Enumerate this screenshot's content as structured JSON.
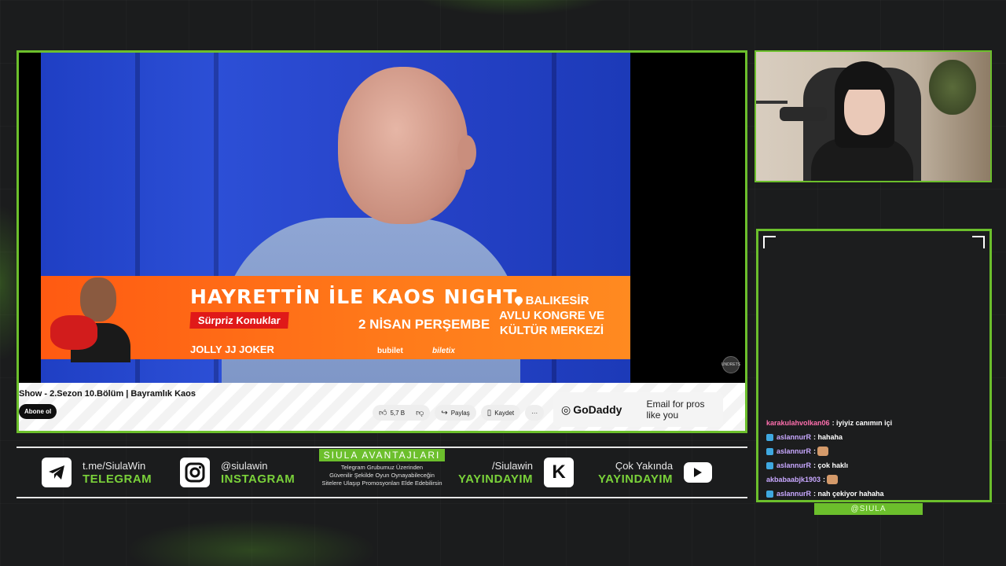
{
  "video": {
    "title": "Show - 2.Sezon 10.Bölüm | Bayramlık Kaos",
    "subscribe_label": "Abone ol",
    "like_count": "5,7 B",
    "share_label": "Paylaş",
    "save_label": "Kaydet",
    "more_label": "···",
    "channel_logo_text": "UNDRETS"
  },
  "banner": {
    "title": "HAYRETTİN İLE KAOS NIGHT",
    "badge": "Sürpriz Konuklar",
    "date": "2 NİSAN PERŞEMBE",
    "venue_line1": "BALIKESİR",
    "venue_line2": "AVLU KONGRE VE",
    "venue_line3": "KÜLTÜR MERKEZİ",
    "brand": "JOLLY JJ JOKER",
    "sponsor1": "bubilet",
    "sponsor2": "biletix"
  },
  "ad": {
    "brand": "GoDaddy",
    "text_line1": "Email for pros",
    "text_line2": "like you"
  },
  "chat": {
    "messages": [
      {
        "user": "karakulahvolkan06",
        "user_color": "#ff6fae",
        "text": ": iyiyiz canımın içi",
        "badge": false,
        "emote": false
      },
      {
        "user": "aslannurR",
        "user_color": "#c8a8ff",
        "text": ": hahaha",
        "badge": true,
        "emote": false
      },
      {
        "user": "aslannurR",
        "user_color": "#c8a8ff",
        "text": ":",
        "badge": true,
        "emote": true
      },
      {
        "user": "aslannurR",
        "user_color": "#c8a8ff",
        "text": ": çok haklı",
        "badge": true,
        "emote": false
      },
      {
        "user": "akbabaabjk1903",
        "user_color": "#c8a8ff",
        "text": ":",
        "badge": false,
        "emote": true
      },
      {
        "user": "aslannurR",
        "user_color": "#c8a8ff",
        "text": ": nah çekiyor hahaha",
        "badge": true,
        "emote": false
      }
    ]
  },
  "handle": "@SIULA",
  "bottom_bar": {
    "telegram": {
      "top": "t.me/SiulaWin",
      "bottom": "TELEGRAM"
    },
    "instagram": {
      "top": "@siulawin",
      "bottom": "INSTAGRAM"
    },
    "center": {
      "title": "SIULA AVANTAJLARI",
      "line1": "Telegram Grubumuz Üzerinden",
      "line2": "Güvenilir Şekilde Oyun Oynayabileceğin",
      "line3": "Sitelere Ulaşıp Promosyonları Elde Edebilirsin"
    },
    "kick": {
      "top": "/Siulawin",
      "bottom": "YAYINDAYIM",
      "icon_letter": "K"
    },
    "youtube": {
      "top": "Çok Yakında",
      "bottom": "YAYINDAYIM"
    }
  },
  "colors": {
    "accent": "#6cbf2c",
    "background": "#1b1c1d",
    "banner_orange": "#ff6a18"
  }
}
